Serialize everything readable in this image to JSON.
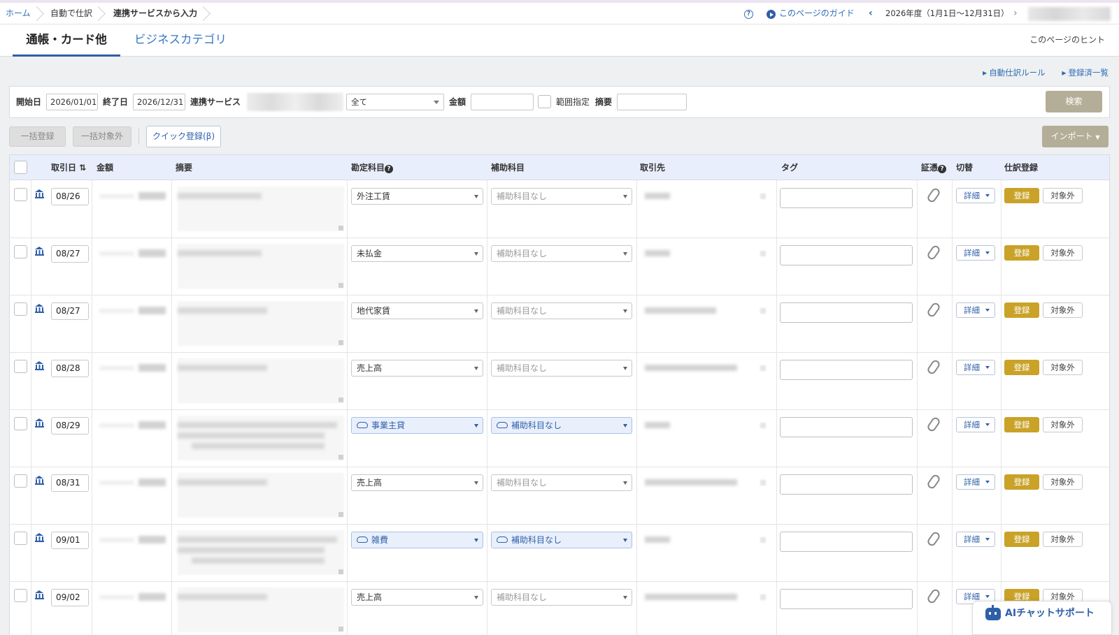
{
  "breadcrumb": {
    "home": "ホーム",
    "auto": "自動で仕訳",
    "current": "連携サービスから入力"
  },
  "header": {
    "help_icon": "question-circle-icon",
    "guide": "このページのガイド",
    "period": "2026年度（1月1日〜12月31日）",
    "prev_icon": "chevron-left-icon",
    "next_icon": "chevron-right-icon"
  },
  "tabs": [
    {
      "label": "通帳・カード他",
      "active": true
    },
    {
      "label": "ビジネスカテゴリ",
      "active": false
    }
  ],
  "hint": "このページのヒント",
  "links": {
    "auto_rules": "自動仕訳ルール",
    "registered_list": "登録済一覧"
  },
  "filter": {
    "start_label": "開始日",
    "start_value": "2026/01/01",
    "end_label": "終了日",
    "end_value": "2026/12/31",
    "service_label": "連携サービス",
    "all_option": "全て",
    "amount_label": "金額",
    "range_label": "範囲指定",
    "memo_label": "摘要",
    "search": "検索"
  },
  "actions": {
    "bulk_register": "一括登録",
    "bulk_exclude": "一括対象外",
    "quick_register": "クイック登録(β)",
    "import": "インポート"
  },
  "columns": {
    "date": "取引日",
    "amount": "金額",
    "description": "摘要",
    "account": "勘定科目",
    "sub_account": "補助科目",
    "partner": "取引先",
    "tag": "タグ",
    "evidence": "証憑",
    "switch": "切替",
    "journal": "仕訳登録"
  },
  "row_buttons": {
    "detail": "詳細",
    "register": "登録",
    "exclude": "対象外"
  },
  "rows": [
    {
      "date": "08/26",
      "account": "外注工賃",
      "sub_account": "補助科目なし",
      "ai": false
    },
    {
      "date": "08/27",
      "account": "未払金",
      "sub_account": "補助科目なし",
      "ai": false
    },
    {
      "date": "08/27",
      "account": "地代家賃",
      "sub_account": "補助科目なし",
      "ai": false
    },
    {
      "date": "08/28",
      "account": "売上高",
      "sub_account": "補助科目なし",
      "ai": false
    },
    {
      "date": "08/29",
      "account": "事業主貸",
      "sub_account": "補助科目なし",
      "ai": true
    },
    {
      "date": "08/31",
      "account": "売上高",
      "sub_account": "補助科目なし",
      "ai": false
    },
    {
      "date": "09/01",
      "account": "雑費",
      "sub_account": "補助科目なし",
      "ai": true
    },
    {
      "date": "09/02",
      "account": "売上高",
      "sub_account": "補助科目なし",
      "ai": false
    }
  ],
  "ai_chat": "AIチャットサポート",
  "colors": {
    "primary": "#2f5fa8",
    "register": "#c9a227",
    "disabled": "#b4ad98",
    "header_bg": "#e8eefb"
  }
}
